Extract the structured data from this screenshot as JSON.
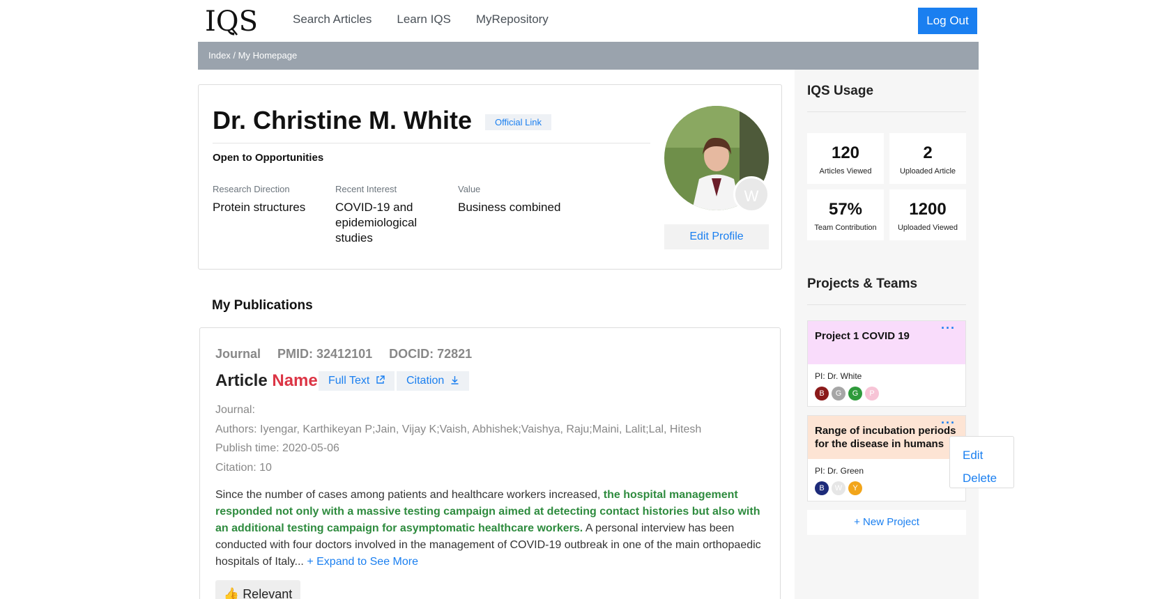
{
  "nav": {
    "logo": "IQS",
    "links": [
      "Search Articles",
      "Learn IQS",
      "MyRepository"
    ],
    "logout": "Log Out"
  },
  "breadcrumb": "Index / My Homepage",
  "profile": {
    "name": "Dr. Christine M. White",
    "official_link": "Official Link",
    "status": "Open to Opportunities",
    "fields": [
      {
        "label": "Research Direction",
        "value": "Protein structures"
      },
      {
        "label": "Recent Interest",
        "value": "COVID-19 and epidemiological studies"
      },
      {
        "label": "Value",
        "value": "Business combined"
      }
    ],
    "avatar_badge": "W",
    "edit_button": "Edit Profile"
  },
  "publications": {
    "heading": "My Publications",
    "item": {
      "type": "Journal",
      "pmid": "PMID: 32412101",
      "docid": "DOCID: 72821",
      "title_main": "Article",
      "title_accent": "Name",
      "full_text": "Full Text",
      "citation_btn": "Citation",
      "journal": "Journal:",
      "authors": "Authors: Iyengar, Karthikeyan P;Jain, Vijay K;Vaish, Abhishek;Vaishya, Raju;Maini, Lalit;Lal, Hitesh",
      "publish_time": "Publish time: 2020-05-06",
      "citation": "Citation: 10",
      "abstract_pre": "Since the number of cases among patients and healthcare workers increased, ",
      "abstract_highlight": "the hospital management responded not only with a massive testing campaign aimed at detecting contact histories but also with an additional testing campaign for asymptomatic healthcare workers.",
      "abstract_post": " A personal interview has been conducted with four doctors involved in the management of COVID-19 outbreak in one of the main orthopaedic hospitals of Italy... ",
      "expand": "+ Expand to See More",
      "relevant": "Relevant"
    }
  },
  "sidebar": {
    "usage_title": "IQS Usage",
    "stats": [
      {
        "num": "120",
        "label": "Articles Viewed"
      },
      {
        "num": "2",
        "label": "Uploaded Article"
      },
      {
        "num": "57%",
        "label": "Team Contribution"
      },
      {
        "num": "1200",
        "label": "Uploaded Viewed"
      }
    ],
    "projects_title": "Projects & Teams",
    "projects": [
      {
        "title": "Project 1 COVID 19",
        "pi": "PI: Dr. White",
        "bg": "#f9dcfb",
        "members": [
          {
            "l": "B",
            "c": "#8b1a1a"
          },
          {
            "l": "G",
            "c": "#a6a6a6"
          },
          {
            "l": "G",
            "c": "#2e9a3b"
          },
          {
            "l": "P",
            "c": "#f7c4d6"
          }
        ]
      },
      {
        "title": "Range of incubation periods for the disease in humans",
        "pi": "PI: Dr. Green",
        "bg": "#fde4d4",
        "members": [
          {
            "l": "B",
            "c": "#1d2b7a"
          },
          {
            "l": "W",
            "c": "#e6e6e6"
          },
          {
            "l": "Y",
            "c": "#f2a51a"
          }
        ]
      }
    ],
    "new_project": "+ New Project",
    "menu": [
      "Edit",
      "Delete"
    ]
  }
}
